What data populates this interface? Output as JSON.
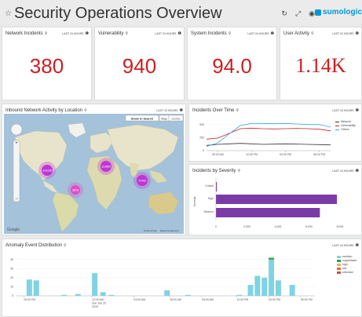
{
  "header": {
    "title": "Security Operations Overview",
    "logo_text": "sumologic"
  },
  "panels": {
    "network_incidents": {
      "title": "Network Incidents",
      "range": "LAST 24 HOURS",
      "value": "380"
    },
    "vulnerability": {
      "title": "Vulnerability",
      "range": "LAST 24 HOURS",
      "value": "940"
    },
    "system_incidents": {
      "title": "System Incidents",
      "range": "LAST 24 HOURS",
      "value": "94.0"
    },
    "user_activity": {
      "title": "User Activity",
      "range": "LAST 24 HOURS",
      "value": "1.14K"
    },
    "map": {
      "title": "Inbound Network Activity by Location",
      "range": "LAST 15 HOURS",
      "show_in_search": "Show In Search",
      "map_btn": "Map",
      "satellite_btn": "Satellite",
      "google": "Google",
      "terms": "Terms of Use",
      "report": "Report a map error",
      "clusters": [
        {
          "label": "316156",
          "color": "#c034d8"
        },
        {
          "label": "113860",
          "color": "#c034d8"
        },
        {
          "label": "72442",
          "color": "#c034d8"
        },
        {
          "label": "3878",
          "color": "#e14ec8"
        }
      ]
    },
    "incidents_over_time": {
      "title": "Incidents Over Time",
      "range": "LAST 15 HOURS",
      "yticks": [
        "500",
        "250",
        "0"
      ],
      "xticks": [
        "09:00 AM",
        "12:00 PM",
        "03:00 PM",
        "06:00 PM"
      ],
      "legend": [
        {
          "name": "Network",
          "color": "#333333"
        },
        {
          "name": "Vulnerability",
          "color": "#cc1f1f"
        },
        {
          "name": "Others",
          "color": "#3da6d9"
        }
      ]
    },
    "incidents_by_severity": {
      "title": "Incidents by Severity",
      "range": "LAST 24 HOURS",
      "ylabel": "Severity",
      "xticks": [
        "0",
        "2,000",
        "4,000",
        "6,000",
        "8,000"
      ]
    },
    "anomaly": {
      "title": "Anomaly Event Distribution",
      "range": "LAST 24 HOURS",
      "yticks": [
        "40",
        "30",
        "20",
        "10",
        "0"
      ],
      "xticks": [
        "09:00 PM",
        "12:00 AM",
        "03:00 AM",
        "06:00 AM",
        "09:00 AM",
        "12:00 PM",
        "03:00 PM",
        "06:00 PM"
      ],
      "xdate": [
        "Sun Jan 25",
        "2015"
      ],
      "legend": [
        {
          "name": "medium",
          "color": "#7fd3e3"
        },
        {
          "name": "suppressed",
          "color": "#2aa245"
        },
        {
          "name": "high",
          "color": "#f0b55b"
        },
        {
          "name": "low",
          "color": "#e86a2f"
        },
        {
          "name": "unknown",
          "color": "#d44a4a"
        }
      ]
    }
  },
  "chart_data": [
    {
      "type": "line",
      "title": "Incidents Over Time",
      "x": [
        "08:00 AM",
        "09:00 AM",
        "10:00 AM",
        "11:00 AM",
        "12:00 PM",
        "01:00 PM",
        "02:00 PM",
        "03:00 PM",
        "04:00 PM",
        "05:00 PM",
        "06:00 PM",
        "07:00 PM"
      ],
      "ylim": [
        0,
        600
      ],
      "series": [
        {
          "name": "Network",
          "values": [
            100,
            120,
            130,
            140,
            130,
            120,
            125,
            130,
            125,
            120,
            115,
            110
          ]
        },
        {
          "name": "Vulnerability",
          "values": [
            220,
            240,
            330,
            420,
            430,
            420,
            415,
            420,
            425,
            420,
            410,
            380
          ]
        },
        {
          "name": "Others",
          "values": [
            80,
            150,
            320,
            480,
            520,
            520,
            515,
            520,
            510,
            500,
            500,
            450
          ]
        }
      ]
    },
    {
      "type": "bar",
      "title": "Incidents by Severity",
      "orientation": "horizontal",
      "categories": [
        "Critical",
        "High",
        "Medium"
      ],
      "values": [
        60,
        7800,
        6700
      ],
      "xlim": [
        0,
        8000
      ]
    },
    {
      "type": "bar",
      "title": "Anomaly Event Distribution",
      "x": [
        "08:00 PM",
        "08:30 PM",
        "09:00 PM",
        "09:30 PM",
        "10:00 PM",
        "10:30 PM",
        "11:00 PM",
        "11:30 PM",
        "12:00 AM",
        "12:30 AM",
        "01:00 AM",
        "03:00 AM",
        "06:00 AM",
        "08:00 AM",
        "12:00 PM",
        "01:00 PM",
        "02:00 PM",
        "02:30 PM",
        "03:00 PM",
        "03:30 PM",
        "04:00 PM",
        "05:00 PM"
      ],
      "ylim": [
        0,
        45
      ],
      "series": [
        {
          "name": "medium",
          "values": [
            18,
            17,
            0,
            0,
            1,
            0,
            2,
            0,
            25,
            4,
            1,
            0,
            6,
            1,
            0,
            1,
            12,
            22,
            20,
            40,
            17,
            12
          ]
        },
        {
          "name": "suppressed",
          "values": [
            0,
            0,
            0,
            0,
            0,
            0,
            0,
            0,
            0,
            0,
            0,
            0,
            0,
            0,
            0,
            0,
            0,
            0,
            0,
            2,
            0,
            0
          ]
        }
      ]
    }
  ]
}
